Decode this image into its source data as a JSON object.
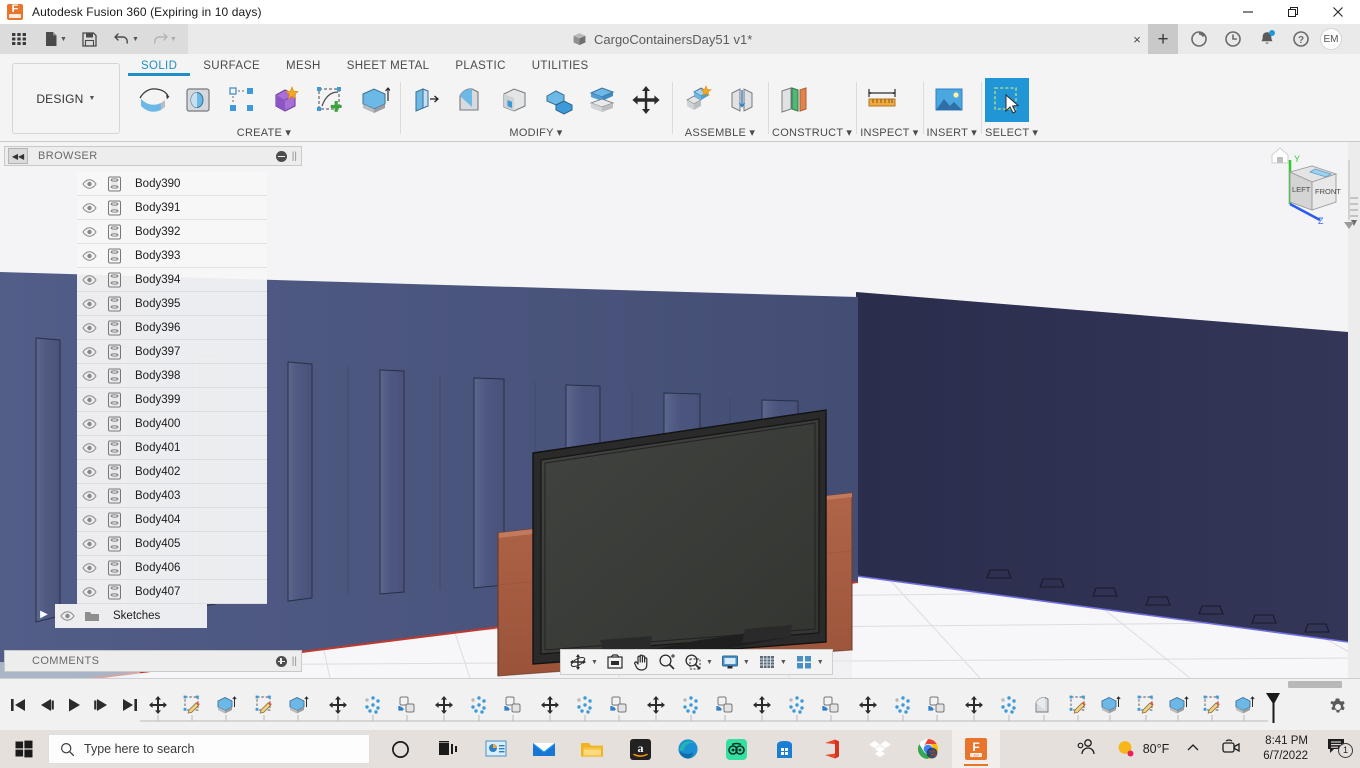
{
  "window": {
    "app_title": "Autodesk Fusion 360 (Expiring in 10 days)",
    "minimize_label": "Minimize",
    "maximize_label": "Restore",
    "close_label": "Close"
  },
  "quick_access": {
    "items": [
      {
        "name": "app-grid-button",
        "label": "Show Data Panel"
      },
      {
        "name": "new-file-button",
        "label": "New"
      },
      {
        "name": "save-button",
        "label": "Save"
      },
      {
        "name": "undo-button",
        "label": "Undo"
      },
      {
        "name": "redo-button",
        "label": "Redo"
      }
    ]
  },
  "document_tab": {
    "title": "CargoContainersDay51 v1*",
    "close_label": "×",
    "new_tab_label": "+"
  },
  "tab_icons": [
    {
      "name": "job-status-icon",
      "label": "Job Status"
    },
    {
      "name": "recent-icon",
      "label": "Recent"
    },
    {
      "name": "notifications-icon",
      "label": "Notifications"
    },
    {
      "name": "help-icon",
      "label": "Help"
    }
  ],
  "account": {
    "initials": "EM"
  },
  "ribbon": {
    "workspace_label": "DESIGN",
    "tabs": [
      {
        "label": "SOLID",
        "active": true
      },
      {
        "label": "SURFACE",
        "active": false
      },
      {
        "label": "MESH",
        "active": false
      },
      {
        "label": "SHEET METAL",
        "active": false
      },
      {
        "label": "PLASTIC",
        "active": false
      },
      {
        "label": "UTILITIES",
        "active": false
      }
    ],
    "panels": [
      {
        "label": "CREATE ▾",
        "tools": [
          "revolve-tool",
          "sweep-tool",
          "rectangular-pattern-tool",
          "combine-tool",
          "create-sketch-tool",
          "extrude-tool"
        ]
      },
      {
        "label": "MODIFY ▾",
        "tools": [
          "press-pull-tool",
          "fillet-tool",
          "shell-tool",
          "draft-tool",
          "offset-face-tool",
          "move-copy-tool"
        ]
      },
      {
        "label": "ASSEMBLE ▾",
        "tools": [
          "new-component-tool",
          "joint-tool"
        ]
      },
      {
        "label": "CONSTRUCT ▾",
        "tools": [
          "offset-plane-tool"
        ]
      },
      {
        "label": "INSPECT ▾",
        "tools": [
          "measure-tool"
        ]
      },
      {
        "label": "INSERT ▾",
        "tools": [
          "insert-image-tool"
        ]
      },
      {
        "label": "SELECT ▾",
        "tools": [
          "select-tool"
        ]
      }
    ]
  },
  "browser": {
    "title": "BROWSER",
    "collapse_label": "◀◀",
    "items": [
      {
        "label": "Body390",
        "type": "body"
      },
      {
        "label": "Body391",
        "type": "body"
      },
      {
        "label": "Body392",
        "type": "body"
      },
      {
        "label": "Body393",
        "type": "body"
      },
      {
        "label": "Body394",
        "type": "body"
      },
      {
        "label": "Body395",
        "type": "body"
      },
      {
        "label": "Body396",
        "type": "body"
      },
      {
        "label": "Body397",
        "type": "body"
      },
      {
        "label": "Body398",
        "type": "body"
      },
      {
        "label": "Body399",
        "type": "body"
      },
      {
        "label": "Body400",
        "type": "body"
      },
      {
        "label": "Body401",
        "type": "body"
      },
      {
        "label": "Body402",
        "type": "body"
      },
      {
        "label": "Body403",
        "type": "body"
      },
      {
        "label": "Body404",
        "type": "body"
      },
      {
        "label": "Body405",
        "type": "body"
      },
      {
        "label": "Body406",
        "type": "body"
      },
      {
        "label": "Body407",
        "type": "body"
      }
    ],
    "folder": {
      "label": "Sketches",
      "type": "folder",
      "expander": "▶"
    }
  },
  "comments": {
    "title": "COMMENTS"
  },
  "viewcube": {
    "face_front": "FRONT",
    "face_left": "LEFT",
    "axis_y": "Y",
    "axis_z": "Z",
    "home_label": "Home"
  },
  "nav_bar": {
    "items": [
      {
        "name": "orbit-icon",
        "has_caret": true
      },
      {
        "name": "look-at-icon",
        "has_caret": false
      },
      {
        "name": "pan-icon",
        "has_caret": false
      },
      {
        "name": "zoom-icon",
        "has_caret": false
      },
      {
        "name": "zoom-window-icon",
        "has_caret": true
      },
      {
        "name": "display-settings-icon",
        "has_caret": true
      },
      {
        "name": "grid-snaps-icon",
        "has_caret": true
      },
      {
        "name": "viewports-icon",
        "has_caret": true
      }
    ]
  },
  "timeline": {
    "playback": [
      {
        "name": "go-to-beginning-button",
        "glyph": "⏮"
      },
      {
        "name": "step-back-button",
        "glyph": "◀▏"
      },
      {
        "name": "play-button",
        "glyph": "▶"
      },
      {
        "name": "step-forward-button",
        "glyph": "▏▶"
      },
      {
        "name": "go-to-end-button",
        "glyph": "⏭"
      }
    ],
    "features": [
      "move-copy",
      "sketch",
      "extrude",
      "sketch",
      "extrude",
      "move-copy",
      "pattern",
      "copy-paste",
      "move-copy",
      "pattern",
      "copy-paste",
      "move-copy",
      "pattern",
      "copy-paste",
      "move-copy",
      "pattern",
      "copy-paste",
      "move-copy",
      "pattern",
      "copy-paste",
      "move-copy",
      "pattern",
      "copy-paste",
      "move-copy",
      "pattern",
      "copy-paste",
      "move-copy",
      "pattern",
      "copy-paste",
      "move-copy",
      "pattern",
      "copy-paste",
      "move-copy",
      "pattern",
      "copy-paste",
      "move-copy",
      "pattern",
      "copy-paste",
      "move-copy",
      "pattern",
      "copy-paste",
      "fillet",
      "sketch",
      "extrude",
      "sketch",
      "extrude",
      "sketch",
      "extrude",
      "fillet",
      "sketch",
      "extrude",
      "sketch",
      "extrude"
    ],
    "settings_label": "Timeline settings"
  },
  "taskbar": {
    "start_label": "Start",
    "search_placeholder": "Type here to search",
    "apps": [
      {
        "name": "cortana-icon",
        "label": "Cortana"
      },
      {
        "name": "task-view-icon",
        "label": "Task View"
      },
      {
        "name": "powerpoint-icon",
        "label": "PowerPoint"
      },
      {
        "name": "mail-icon",
        "label": "Mail"
      },
      {
        "name": "file-explorer-icon",
        "label": "File Explorer"
      },
      {
        "name": "amazon-icon",
        "label": "Amazon"
      },
      {
        "name": "edge-icon",
        "label": "Microsoft Edge"
      },
      {
        "name": "tripadvisor-icon",
        "label": "Tripadvisor"
      },
      {
        "name": "microsoft-store-icon",
        "label": "Microsoft Store"
      },
      {
        "name": "office-icon",
        "label": "Office"
      },
      {
        "name": "dropbox-icon",
        "label": "Dropbox"
      },
      {
        "name": "chrome-icon",
        "label": "Google Chrome"
      },
      {
        "name": "fusion360-icon",
        "label": "Autodesk Fusion 360"
      }
    ],
    "weather": "80°F",
    "time": "8:41 PM",
    "date": "6/7/2022",
    "notification_count": "1",
    "chevron": "⌃"
  },
  "colors": {
    "accent": "#1f8ec9",
    "select_highlight": "#2196d6",
    "wall_left": "#4b5680",
    "wall_right": "#2f3152",
    "cabinet": "#a85c3d",
    "tv_bezel": "#262626",
    "tv_screen": "#3b3c3a",
    "floor": "#f4f4f6",
    "taskbar_bg": "#e6e0dc",
    "fusion_orange": "#e8752b"
  }
}
